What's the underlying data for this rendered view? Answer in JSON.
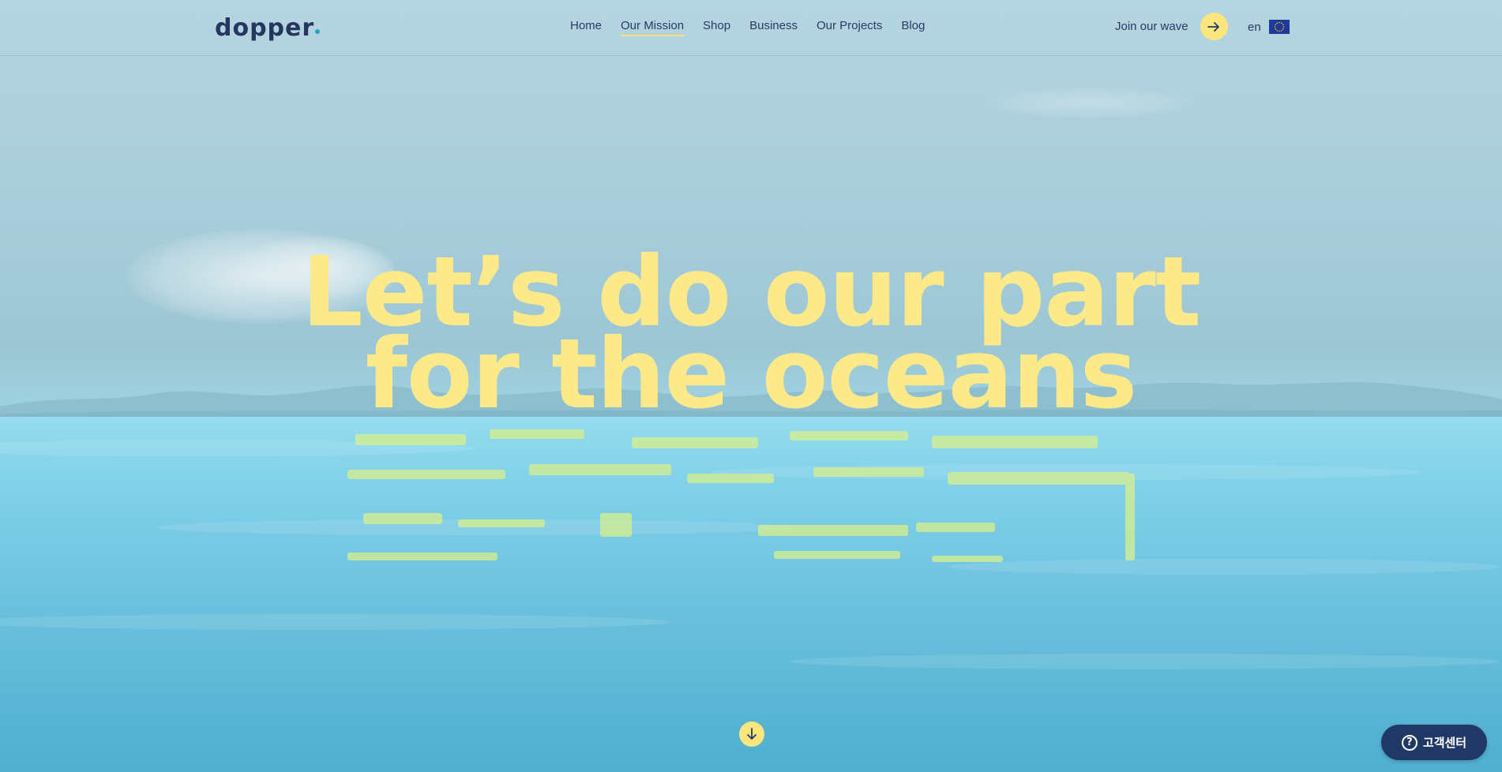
{
  "header": {
    "logo_text": "dopper",
    "nav": [
      {
        "label": "Home",
        "active": false
      },
      {
        "label": "Our Mission",
        "active": true
      },
      {
        "label": "Shop",
        "active": false
      },
      {
        "label": "Business",
        "active": false
      },
      {
        "label": "Our Projects",
        "active": false
      },
      {
        "label": "Blog",
        "active": false
      }
    ],
    "join_label": "Join our wave",
    "join_icon": "arrow-right-icon",
    "language": "en",
    "flag_icon": "eu-flag-icon"
  },
  "hero": {
    "line1": "Let’s do our part",
    "line2": "for the oceans"
  },
  "scroll_icon": "arrow-down-icon",
  "support": {
    "icon": "help-icon",
    "icon_glyph": "?",
    "label": "고객센터"
  },
  "colors": {
    "accent_yellow": "#fbe67d",
    "navy": "#263a66",
    "sky": "#b4d5e0",
    "sea": "#5cb7d4"
  }
}
